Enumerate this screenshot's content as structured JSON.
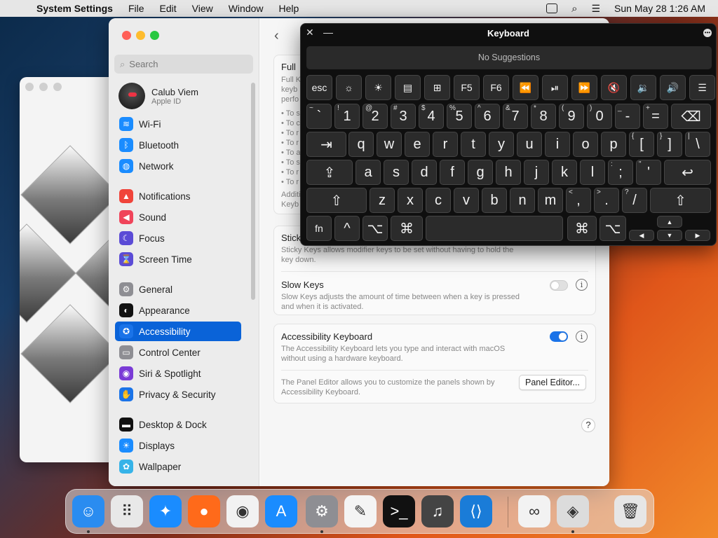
{
  "menubar": {
    "app": "System Settings",
    "items": [
      "File",
      "Edit",
      "View",
      "Window",
      "Help"
    ],
    "clock": "Sun May 28  1:26 AM"
  },
  "settings": {
    "search_placeholder": "Search",
    "user": {
      "name": "Calub Viem",
      "sub": "Apple ID"
    },
    "sidebar": [
      {
        "label": "Wi-Fi",
        "icon": "wifi-icon",
        "color": "#1a8cff",
        "glyph": "≋"
      },
      {
        "label": "Bluetooth",
        "icon": "bluetooth-icon",
        "color": "#1a8cff",
        "glyph": "ᛒ"
      },
      {
        "label": "Network",
        "icon": "globe-icon",
        "color": "#1a8cff",
        "glyph": "◍"
      },
      {
        "label": "Notifications",
        "icon": "bell-icon",
        "color": "#f0443a",
        "glyph": "▲"
      },
      {
        "label": "Sound",
        "icon": "speaker-icon",
        "color": "#f0445a",
        "glyph": "◀"
      },
      {
        "label": "Focus",
        "icon": "moon-icon",
        "color": "#5b4bd6",
        "glyph": "☾"
      },
      {
        "label": "Screen Time",
        "icon": "hourglass-icon",
        "color": "#5b4bd6",
        "glyph": "⌛"
      },
      {
        "label": "General",
        "icon": "gear-icon",
        "color": "#8e8e93",
        "glyph": "⚙"
      },
      {
        "label": "Appearance",
        "icon": "appearance-icon",
        "color": "#111111",
        "glyph": "◐"
      },
      {
        "label": "Accessibility",
        "icon": "accessibility-icon",
        "color": "#1a73e8",
        "glyph": "✪"
      },
      {
        "label": "Control Center",
        "icon": "control-center-icon",
        "color": "#8e8e93",
        "glyph": "▭"
      },
      {
        "label": "Siri & Spotlight",
        "icon": "siri-icon",
        "color": "#7a3bd6",
        "glyph": "◉"
      },
      {
        "label": "Privacy & Security",
        "icon": "hand-icon",
        "color": "#1a73e8",
        "glyph": "✋"
      },
      {
        "label": "Desktop & Dock",
        "icon": "dock-icon",
        "color": "#111111",
        "glyph": "▬"
      },
      {
        "label": "Displays",
        "icon": "display-icon",
        "color": "#1a8cff",
        "glyph": "☀"
      },
      {
        "label": "Wallpaper",
        "icon": "wallpaper-icon",
        "color": "#36b3e8",
        "glyph": "✿"
      }
    ],
    "content": {
      "full_title": "Full",
      "full_desc": [
        "Full K",
        "keyb",
        "perfo"
      ],
      "bullets": [
        "• To s",
        "• To c",
        "• To r",
        "• To r",
        "• To a",
        "• To s",
        "• To r",
        "• To r"
      ],
      "additional": [
        "Additi",
        "Keyb"
      ],
      "sticky_title": "Stick",
      "sticky_desc": [
        "Sticky Keys allows modifier keys to be set without having to hold the",
        "key down."
      ],
      "slow_title": "Slow Keys",
      "slow_desc": [
        "Slow Keys adjusts the amount of time between when a key is pressed",
        "and when it is activated."
      ],
      "ak_title": "Accessibility Keyboard",
      "ak_desc": [
        "The Accessibility Keyboard lets you type and interact with macOS",
        "without using a hardware keyboard."
      ],
      "panel_desc": [
        "The Panel Editor allows you to customize the panels shown by",
        "Accessibility Keyboard."
      ],
      "panel_button": "Panel Editor...",
      "help": "?",
      "slow_toggle": false,
      "ak_toggle": true
    }
  },
  "keyboard": {
    "title": "Keyboard",
    "suggestions": "No Suggestions",
    "frow": [
      "esc",
      "☼",
      "☀",
      "▤",
      "⊞",
      "F5",
      "F6",
      "⏪",
      "⏯",
      "⏩",
      "🔇",
      "🔉",
      "🔊",
      "☰"
    ],
    "row1": [
      [
        "~",
        "`"
      ],
      [
        "!",
        "1"
      ],
      [
        "@",
        "2"
      ],
      [
        "#",
        "3"
      ],
      [
        "$",
        "4"
      ],
      [
        "%",
        "5"
      ],
      [
        "^",
        "6"
      ],
      [
        "&",
        "7"
      ],
      [
        "*",
        "8"
      ],
      [
        "(",
        "9"
      ],
      [
        ")",
        "0"
      ],
      [
        "_",
        "-"
      ],
      [
        "+",
        "="
      ]
    ],
    "delete": "⌫",
    "tab": "⇥",
    "row2": [
      "q",
      "w",
      "e",
      "r",
      "t",
      "y",
      "u",
      "i",
      "o",
      "p"
    ],
    "row2b": [
      [
        "{",
        "["
      ],
      [
        "}",
        "]"
      ],
      [
        "|",
        "\\"
      ]
    ],
    "caps": "⇪",
    "row3": [
      "a",
      "s",
      "d",
      "f",
      "g",
      "h",
      "j",
      "k",
      "l"
    ],
    "row3b": [
      [
        ":",
        ";"
      ],
      [
        "\"",
        "'"
      ]
    ],
    "return": "↩",
    "shift": "⇧",
    "row4": [
      "z",
      "x",
      "c",
      "v",
      "b",
      "n",
      "m"
    ],
    "row4b": [
      [
        "<",
        ","
      ],
      [
        ">",
        "."
      ],
      [
        "?",
        "/"
      ]
    ],
    "fn": "fn",
    "ctrl": "^",
    "opt": "⌥",
    "cmd": "⌘",
    "arrows": {
      "up": "▲",
      "down": "▼",
      "left": "◀",
      "right": "▶"
    }
  },
  "dock": [
    {
      "name": "finder",
      "color": "#2a8cf0",
      "glyph": "☺",
      "running": true
    },
    {
      "name": "launchpad",
      "color": "#e8e8e8",
      "glyph": "⠿",
      "running": false
    },
    {
      "name": "safari",
      "color": "#1a8cff",
      "glyph": "✦",
      "running": false
    },
    {
      "name": "firefox",
      "color": "#ff6a1a",
      "glyph": "●",
      "running": false
    },
    {
      "name": "chrome",
      "color": "#f2f2f2",
      "glyph": "◉",
      "running": false
    },
    {
      "name": "app-store",
      "color": "#1a8cff",
      "glyph": "A",
      "running": false
    },
    {
      "name": "system-settings",
      "color": "#8e8e93",
      "glyph": "⚙",
      "running": true
    },
    {
      "name": "textedit",
      "color": "#f4f4f4",
      "glyph": "✎",
      "running": false
    },
    {
      "name": "terminal",
      "color": "#111111",
      "glyph": ">_",
      "running": false
    },
    {
      "name": "garageband",
      "color": "#444444",
      "glyph": "♫",
      "running": false
    },
    {
      "name": "vscode",
      "color": "#1a7cd8",
      "glyph": "⟨⟩",
      "running": false
    },
    {
      "name": "visual-studio",
      "color": "#f2f2f2",
      "glyph": "∞",
      "running": false
    },
    {
      "name": "boot-camp",
      "color": "#dcdcdc",
      "glyph": "◈",
      "running": true
    },
    {
      "name": "trash",
      "color": "#e6e6e6",
      "glyph": "🗑",
      "running": false
    }
  ]
}
